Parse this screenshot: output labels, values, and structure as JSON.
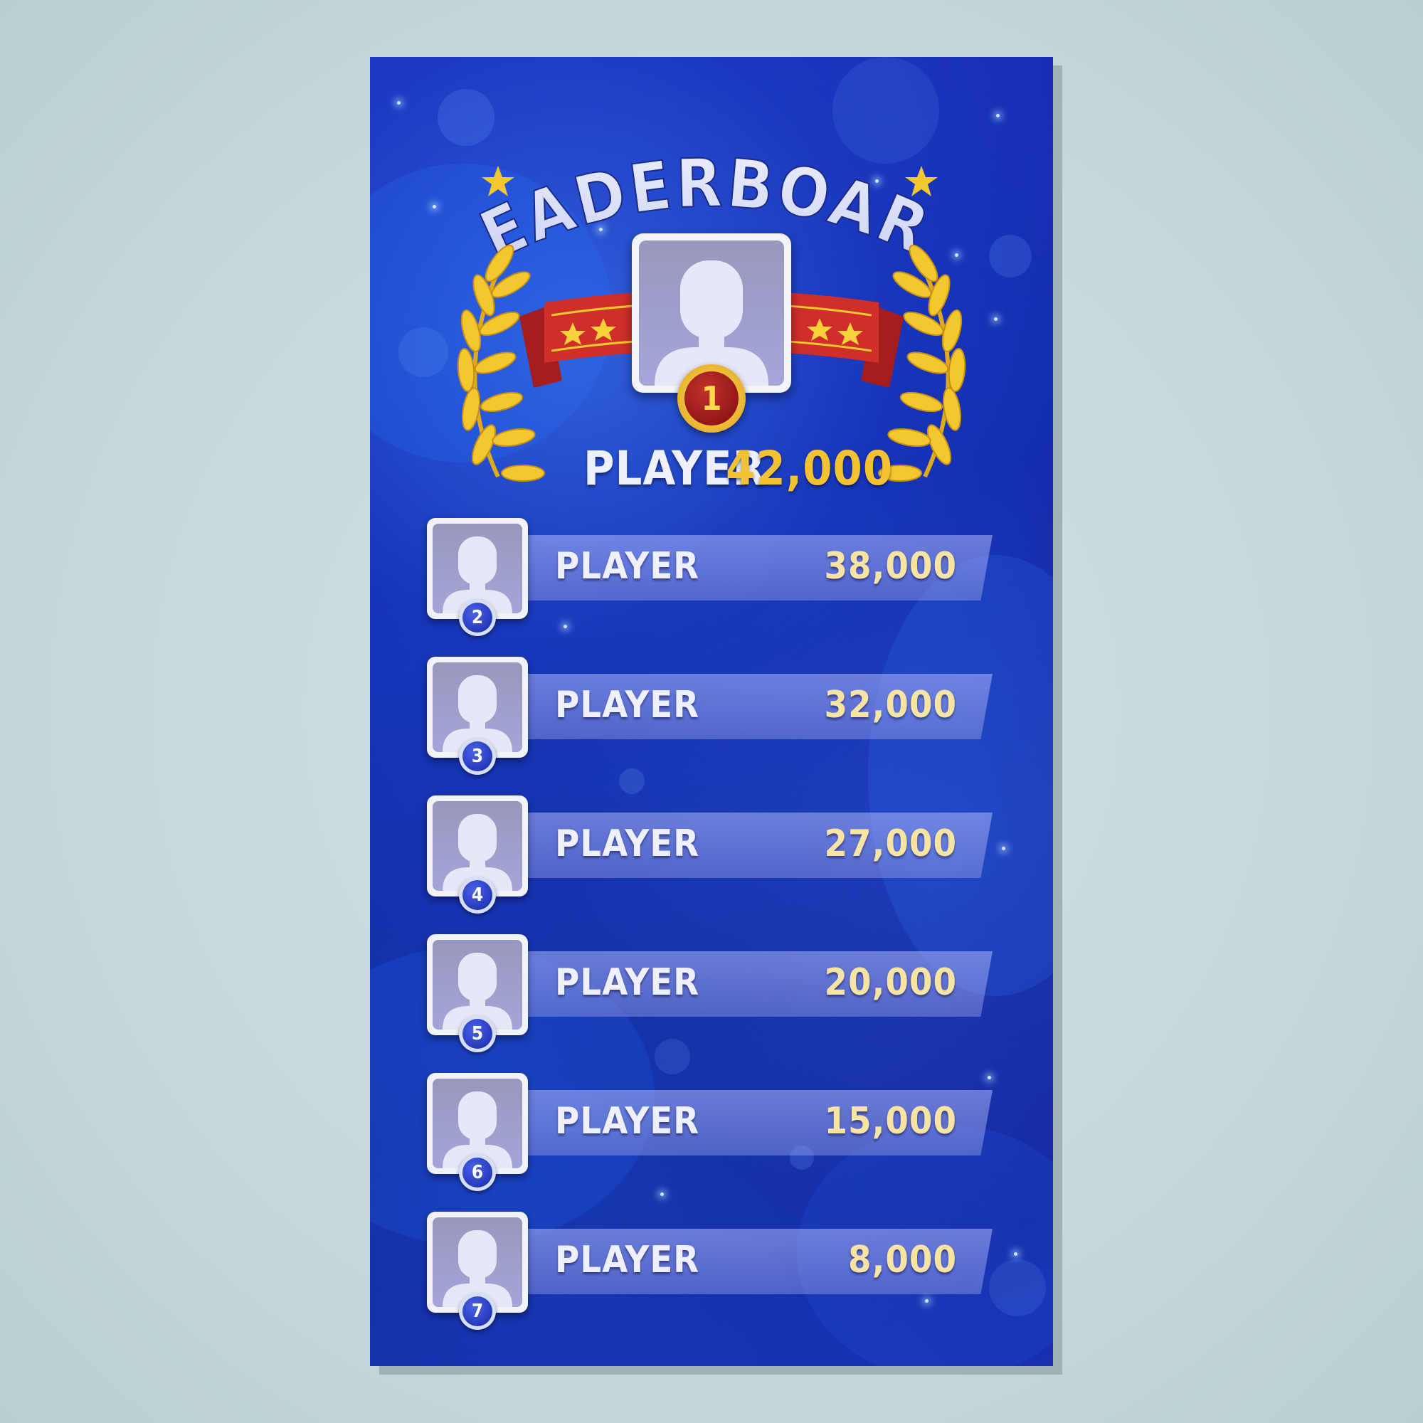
{
  "title": "LEADERBOARD",
  "champion": {
    "rank": "1",
    "name": "PLAYER",
    "score": "42,000"
  },
  "players": [
    {
      "rank": "2",
      "name": "PLAYER",
      "score": "38,000"
    },
    {
      "rank": "3",
      "name": "PLAYER",
      "score": "32,000"
    },
    {
      "rank": "4",
      "name": "PLAYER",
      "score": "27,000"
    },
    {
      "rank": "5",
      "name": "PLAYER",
      "score": "20,000"
    },
    {
      "rank": "6",
      "name": "PLAYER",
      "score": "15,000"
    },
    {
      "rank": "7",
      "name": "PLAYER",
      "score": "8,000"
    }
  ],
  "icons": {
    "title_stars": "star-icon",
    "laurels": "laurel-wreath-icon",
    "ribbon": "ribbon-banner-icon",
    "avatar": "user-silhouette-icon"
  },
  "colors": {
    "card_background": "#1027a8",
    "score_gold": "#f2c233",
    "ribbon_red": "#c62b26",
    "laurel_gold": "#f3c72e"
  }
}
